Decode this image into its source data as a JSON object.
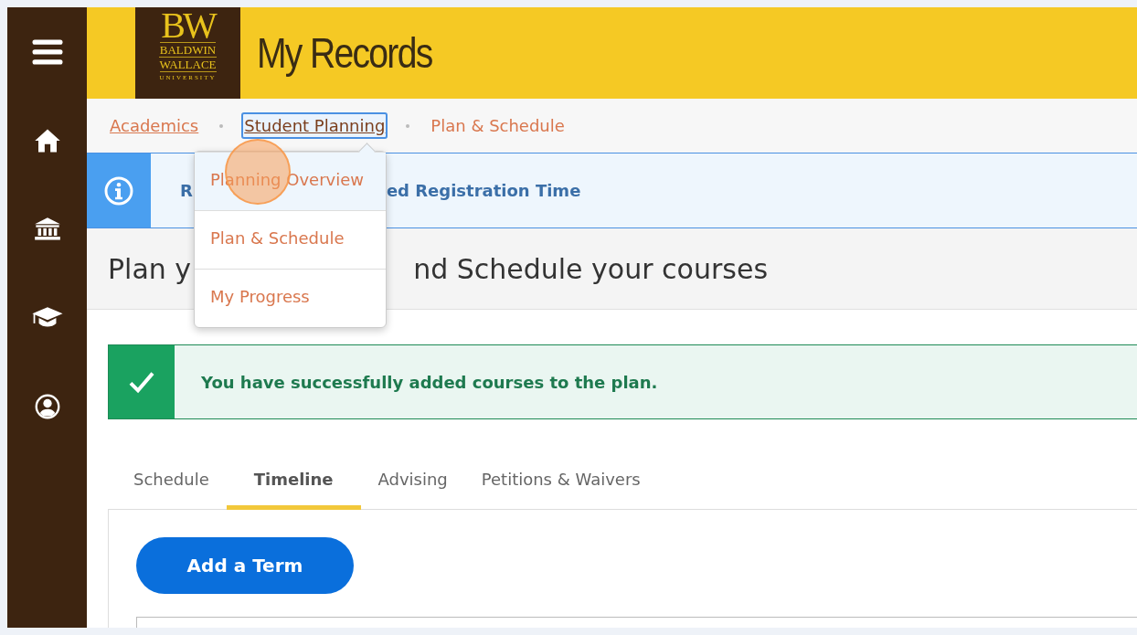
{
  "sidebar": {
    "items": [
      {
        "kind": "menu"
      },
      {
        "kind": "home"
      },
      {
        "kind": "institution"
      },
      {
        "kind": "graduation"
      },
      {
        "kind": "profile"
      }
    ]
  },
  "header": {
    "logo": {
      "initials": "BW",
      "lines": [
        "BALDWIN",
        "WALLACE",
        "UNIVERSITY"
      ]
    },
    "title": "My Records"
  },
  "breadcrumbs": [
    {
      "label": "Academics",
      "kind": "link",
      "focused": false
    },
    {
      "label": "Student Planning",
      "kind": "link",
      "focused": true
    },
    {
      "label": "Plan & Schedule",
      "kind": "current",
      "focused": false
    }
  ],
  "dropdown": {
    "items": [
      {
        "label": "Planning Overview",
        "highlighted": true
      },
      {
        "label": "Plan & Schedule",
        "highlighted": false
      },
      {
        "label": "My Progress",
        "highlighted": false
      }
    ]
  },
  "info_banner": {
    "text_start": "R",
    "text_end": "ed Registration Time"
  },
  "heading": {
    "text_start": "Plan y",
    "text_end": "nd Schedule your courses"
  },
  "success_banner": {
    "text": "You have successfully added courses to the plan."
  },
  "tabs": [
    {
      "label": "Schedule",
      "selected": false
    },
    {
      "label": "Timeline",
      "selected": true
    },
    {
      "label": "Advising",
      "selected": false
    },
    {
      "label": "Petitions & Waivers",
      "selected": false
    }
  ],
  "timeline": {
    "button": "Add a Term"
  }
}
